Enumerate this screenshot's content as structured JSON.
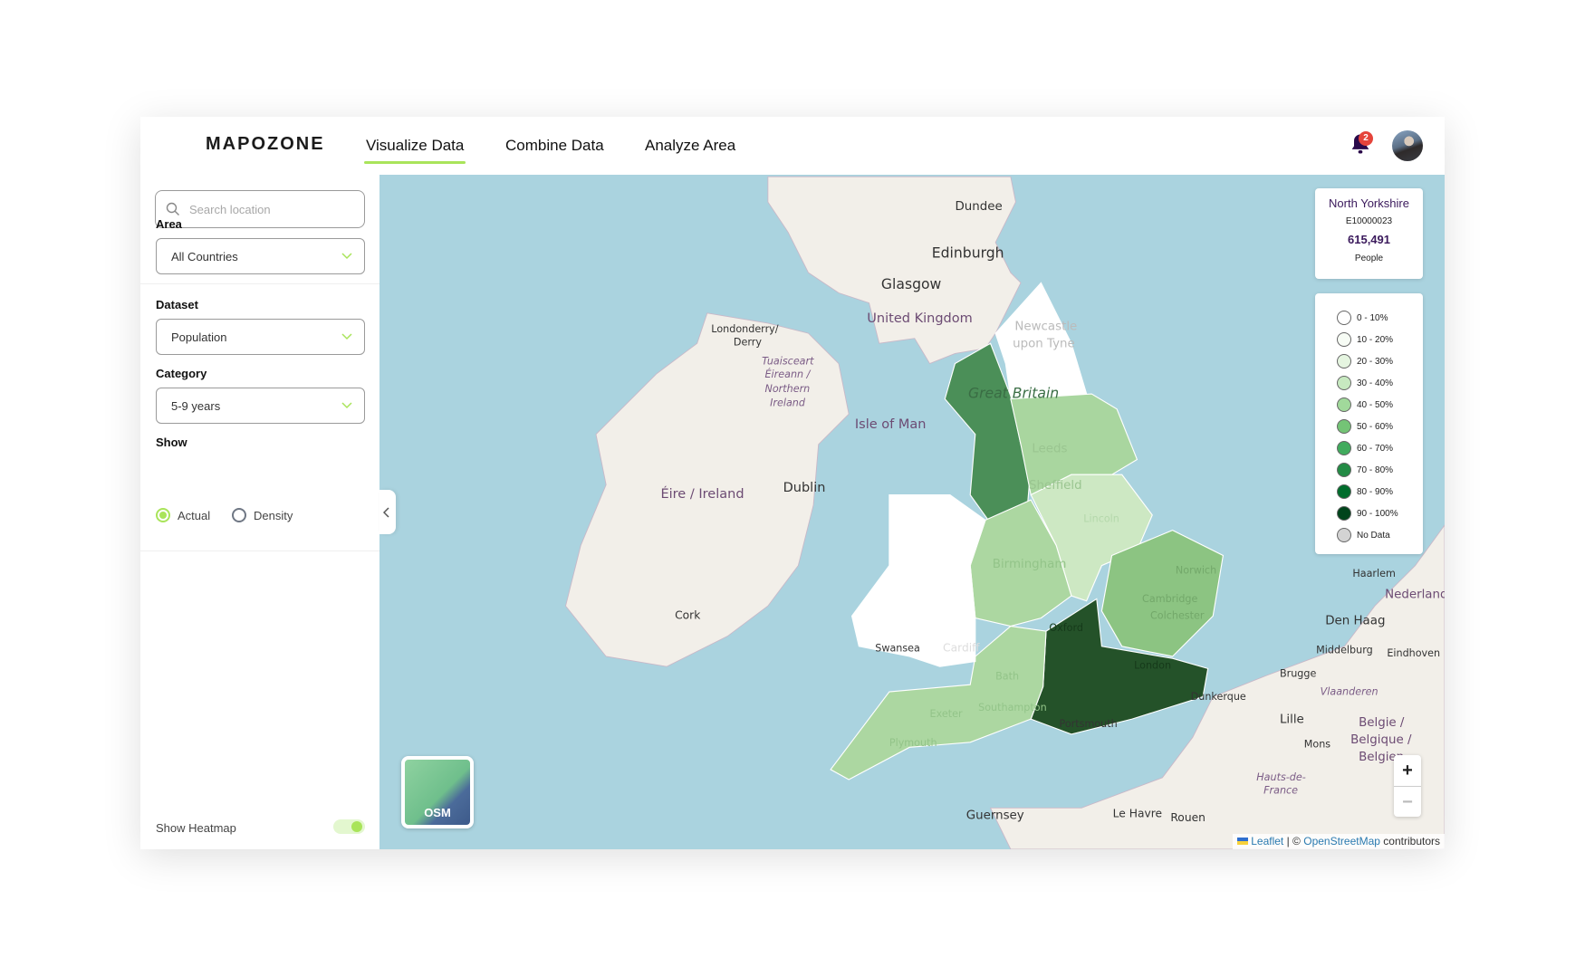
{
  "header": {
    "logo": "MAPOZONE",
    "nav": [
      {
        "label": "Visualize Data",
        "active": true
      },
      {
        "label": "Combine Data"
      },
      {
        "label": "Analyze Area"
      }
    ],
    "notification_count": "2"
  },
  "sidebar": {
    "search_placeholder": "Search location",
    "area": {
      "label": "Area",
      "value": "All Countries"
    },
    "dataset": {
      "label": "Dataset",
      "value": "Population"
    },
    "category": {
      "label": "Category",
      "value": "5-9 years"
    },
    "show": {
      "label": "Show",
      "options": [
        "Actual",
        "Density"
      ],
      "selected": "Actual"
    },
    "heatmap": {
      "label": "Show Heatmap",
      "on": true
    }
  },
  "info": {
    "region": "North Yorkshire",
    "code": "E10000023",
    "value": "615,491",
    "unit": "People"
  },
  "legend": [
    {
      "label": "0 - 10%",
      "color": "#ffffff"
    },
    {
      "label": "10 - 20%",
      "color": "#f7fcf5"
    },
    {
      "label": "20 - 30%",
      "color": "#e5f5e0"
    },
    {
      "label": "30 - 40%",
      "color": "#c7e9c0"
    },
    {
      "label": "40 - 50%",
      "color": "#a1d99b"
    },
    {
      "label": "50 - 60%",
      "color": "#74c476"
    },
    {
      "label": "60 - 70%",
      "color": "#41ab5d"
    },
    {
      "label": "70 - 80%",
      "color": "#238b45"
    },
    {
      "label": "80 - 90%",
      "color": "#006d2c"
    },
    {
      "label": "90 - 100%",
      "color": "#00441b"
    },
    {
      "label": "No Data",
      "color": "#d3d3d3"
    }
  ],
  "map": {
    "labels": [
      "Dundee",
      "Edinburgh",
      "Glasgow",
      "United Kingdom",
      "Londonderry/",
      "Derry",
      "Tuaisceart",
      "Éireann /",
      "Northern",
      "Ireland",
      "Isle of Man",
      "Éire / Ireland",
      "Dublin",
      "Cork",
      "Newcastle",
      "upon Tyne",
      "Great Britain",
      "Leeds",
      "Sheffield",
      "Lincoln",
      "Birmingham",
      "Cambridge",
      "Norwich",
      "Colchester",
      "Oxford",
      "London",
      "Bath",
      "Southampton",
      "Exeter",
      "Plymouth",
      "Portsmouth",
      "Cardiff",
      "Swansea",
      "Dunkerque",
      "Haarlem",
      "Nederland",
      "Den Haag",
      "Middelburg",
      "Brugge",
      "Eindhoven",
      "Vlaanderen",
      "Lille",
      "Mons",
      "Belgie /",
      "Belgique /",
      "Belgien",
      "Hauts-de-",
      "France",
      "Guernsey",
      "Le Havre",
      "Rouen"
    ],
    "zoom_in": "+",
    "zoom_out": "−",
    "layer_button": "OSM",
    "attribution": {
      "leaflet": "Leaflet",
      "sep": "| ©",
      "osm": "OpenStreetMap",
      "rest": "contributors"
    }
  }
}
